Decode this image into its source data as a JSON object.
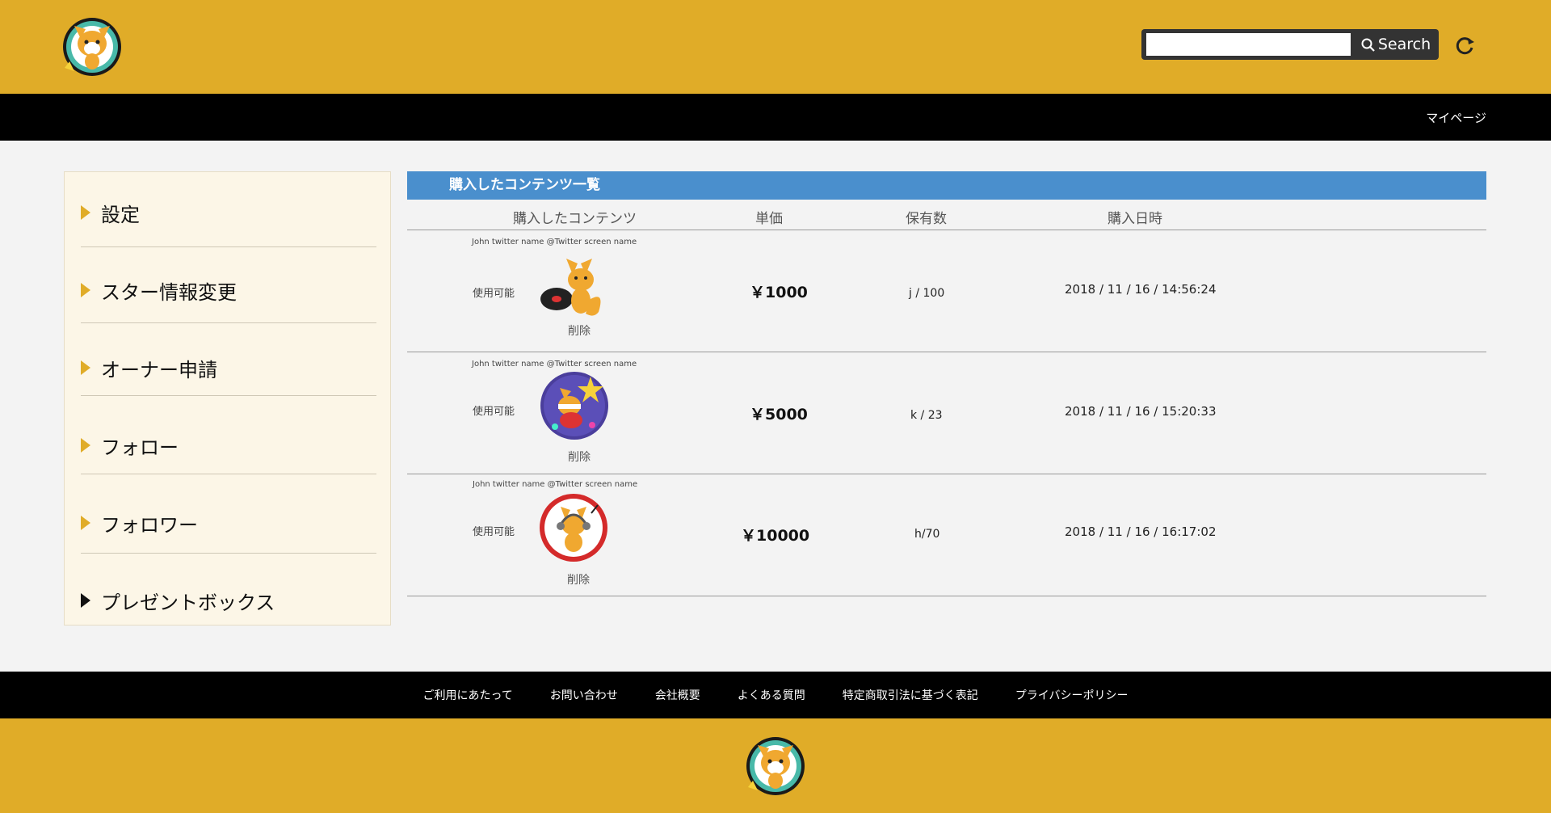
{
  "header": {
    "search_placeholder": "",
    "search_label": "Search"
  },
  "nav": {
    "mypage": "マイページ"
  },
  "sidebar": {
    "items": [
      {
        "label": "設定"
      },
      {
        "label": "スター情報変更"
      },
      {
        "label": "オーナー申請"
      },
      {
        "label": "フォロー"
      },
      {
        "label": "フォロワー"
      },
      {
        "label": "プレゼントボックス"
      }
    ]
  },
  "main": {
    "title": "購入したコンテンツ一覧",
    "columns": [
      "購入したコンテンツ",
      "単価",
      "保有数",
      "購入日時"
    ],
    "rows": [
      {
        "twitter": "John twitter name  @Twitter screen name",
        "status": "使用可能",
        "delete": "削除",
        "price": "￥1000",
        "qty": "j / 100",
        "date": "2018 / 11 / 16 / 14:56:24"
      },
      {
        "twitter": "John twitter name  @Twitter screen name",
        "status": "使用可能",
        "delete": "削除",
        "price": "￥5000",
        "qty": "k / 23",
        "date": "2018 / 11 / 16 / 15:20:33"
      },
      {
        "twitter": "John twitter name  @Twitter screen name",
        "status": "使用可能",
        "delete": "削除",
        "price": "￥10000",
        "qty": "h/70",
        "date": "2018 / 11 / 16 / 16:17:02"
      }
    ]
  },
  "footer": {
    "links": [
      "ご利用にあたって",
      "お問い合わせ",
      "会社概要",
      "よくある質問",
      "特定商取引法に基づく表記",
      "プライバシーポリシー"
    ]
  },
  "colors": {
    "brand_yellow": "#e0ac28",
    "title_blue": "#4a8fcd",
    "sidebar_bg": "#fcf6e7"
  }
}
